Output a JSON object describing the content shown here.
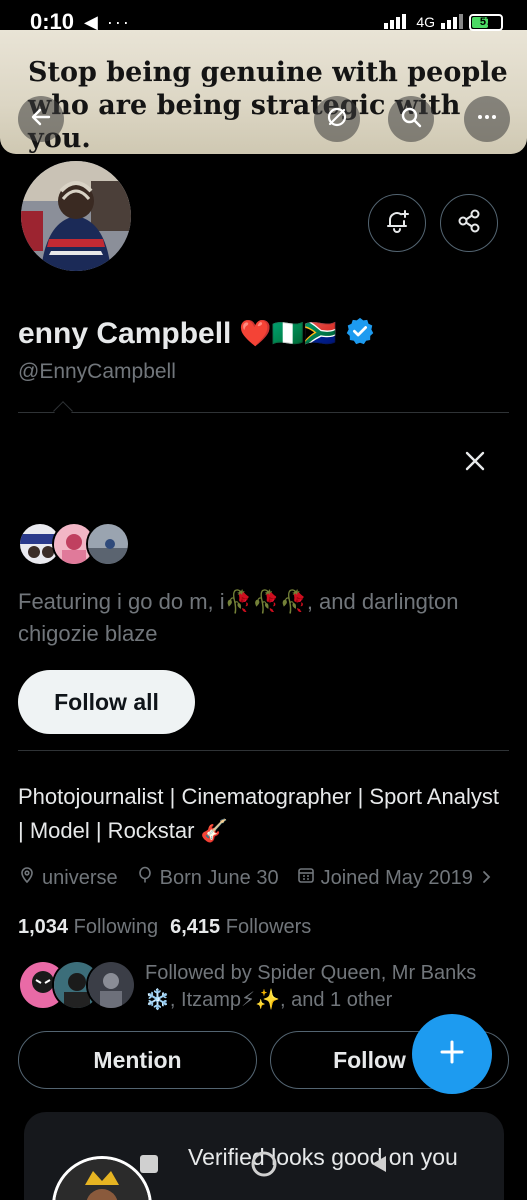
{
  "status_bar": {
    "time": "0:10",
    "notification_icons": "◀ ···",
    "network": "4G",
    "battery": "57",
    "battery_level": 0.57
  },
  "header": {
    "banner_text": "Stop being genuine with people who are being strategic with you.",
    "back_icon": "arrow-left-icon",
    "grok_icon": "grok-icon",
    "search_icon": "search-icon"
  },
  "profile": {
    "display_name": "enny Campbell",
    "emoji_suffix": "❤️🇳🇬🇿🇦",
    "handle": "@EnnyCampbell",
    "verified": true
  },
  "suggestion": {
    "text": "Featuring i go do m, i🥀🥀🥀, and darlington chigozie blaze",
    "follow_all_label": "Follow all"
  },
  "bio": {
    "text": "Photojournalist | Cinematographer | Sport Analyst | Model | Rockstar 🎸"
  },
  "meta": {
    "location": "universe",
    "birthday": "Born June 30",
    "joined": "Joined May 2019"
  },
  "counts": {
    "following_count": "1,034",
    "following_label": "Following",
    "followers_count": "6,415",
    "followers_label": "Followers"
  },
  "followed_by": {
    "text": "Followed by Spider Queen, Mr Banks ❄️, Itzamp⚡✨, and 1 other"
  },
  "actions": {
    "mention_label": "Mention",
    "follow_label": "Follow"
  },
  "promo": {
    "title": "Verified looks good on you"
  },
  "colors": {
    "background": "#000000",
    "primary_text": "#e7e9ea",
    "secondary_text": "#71767b",
    "accent": "#1d9bf0",
    "border": "#536471"
  }
}
